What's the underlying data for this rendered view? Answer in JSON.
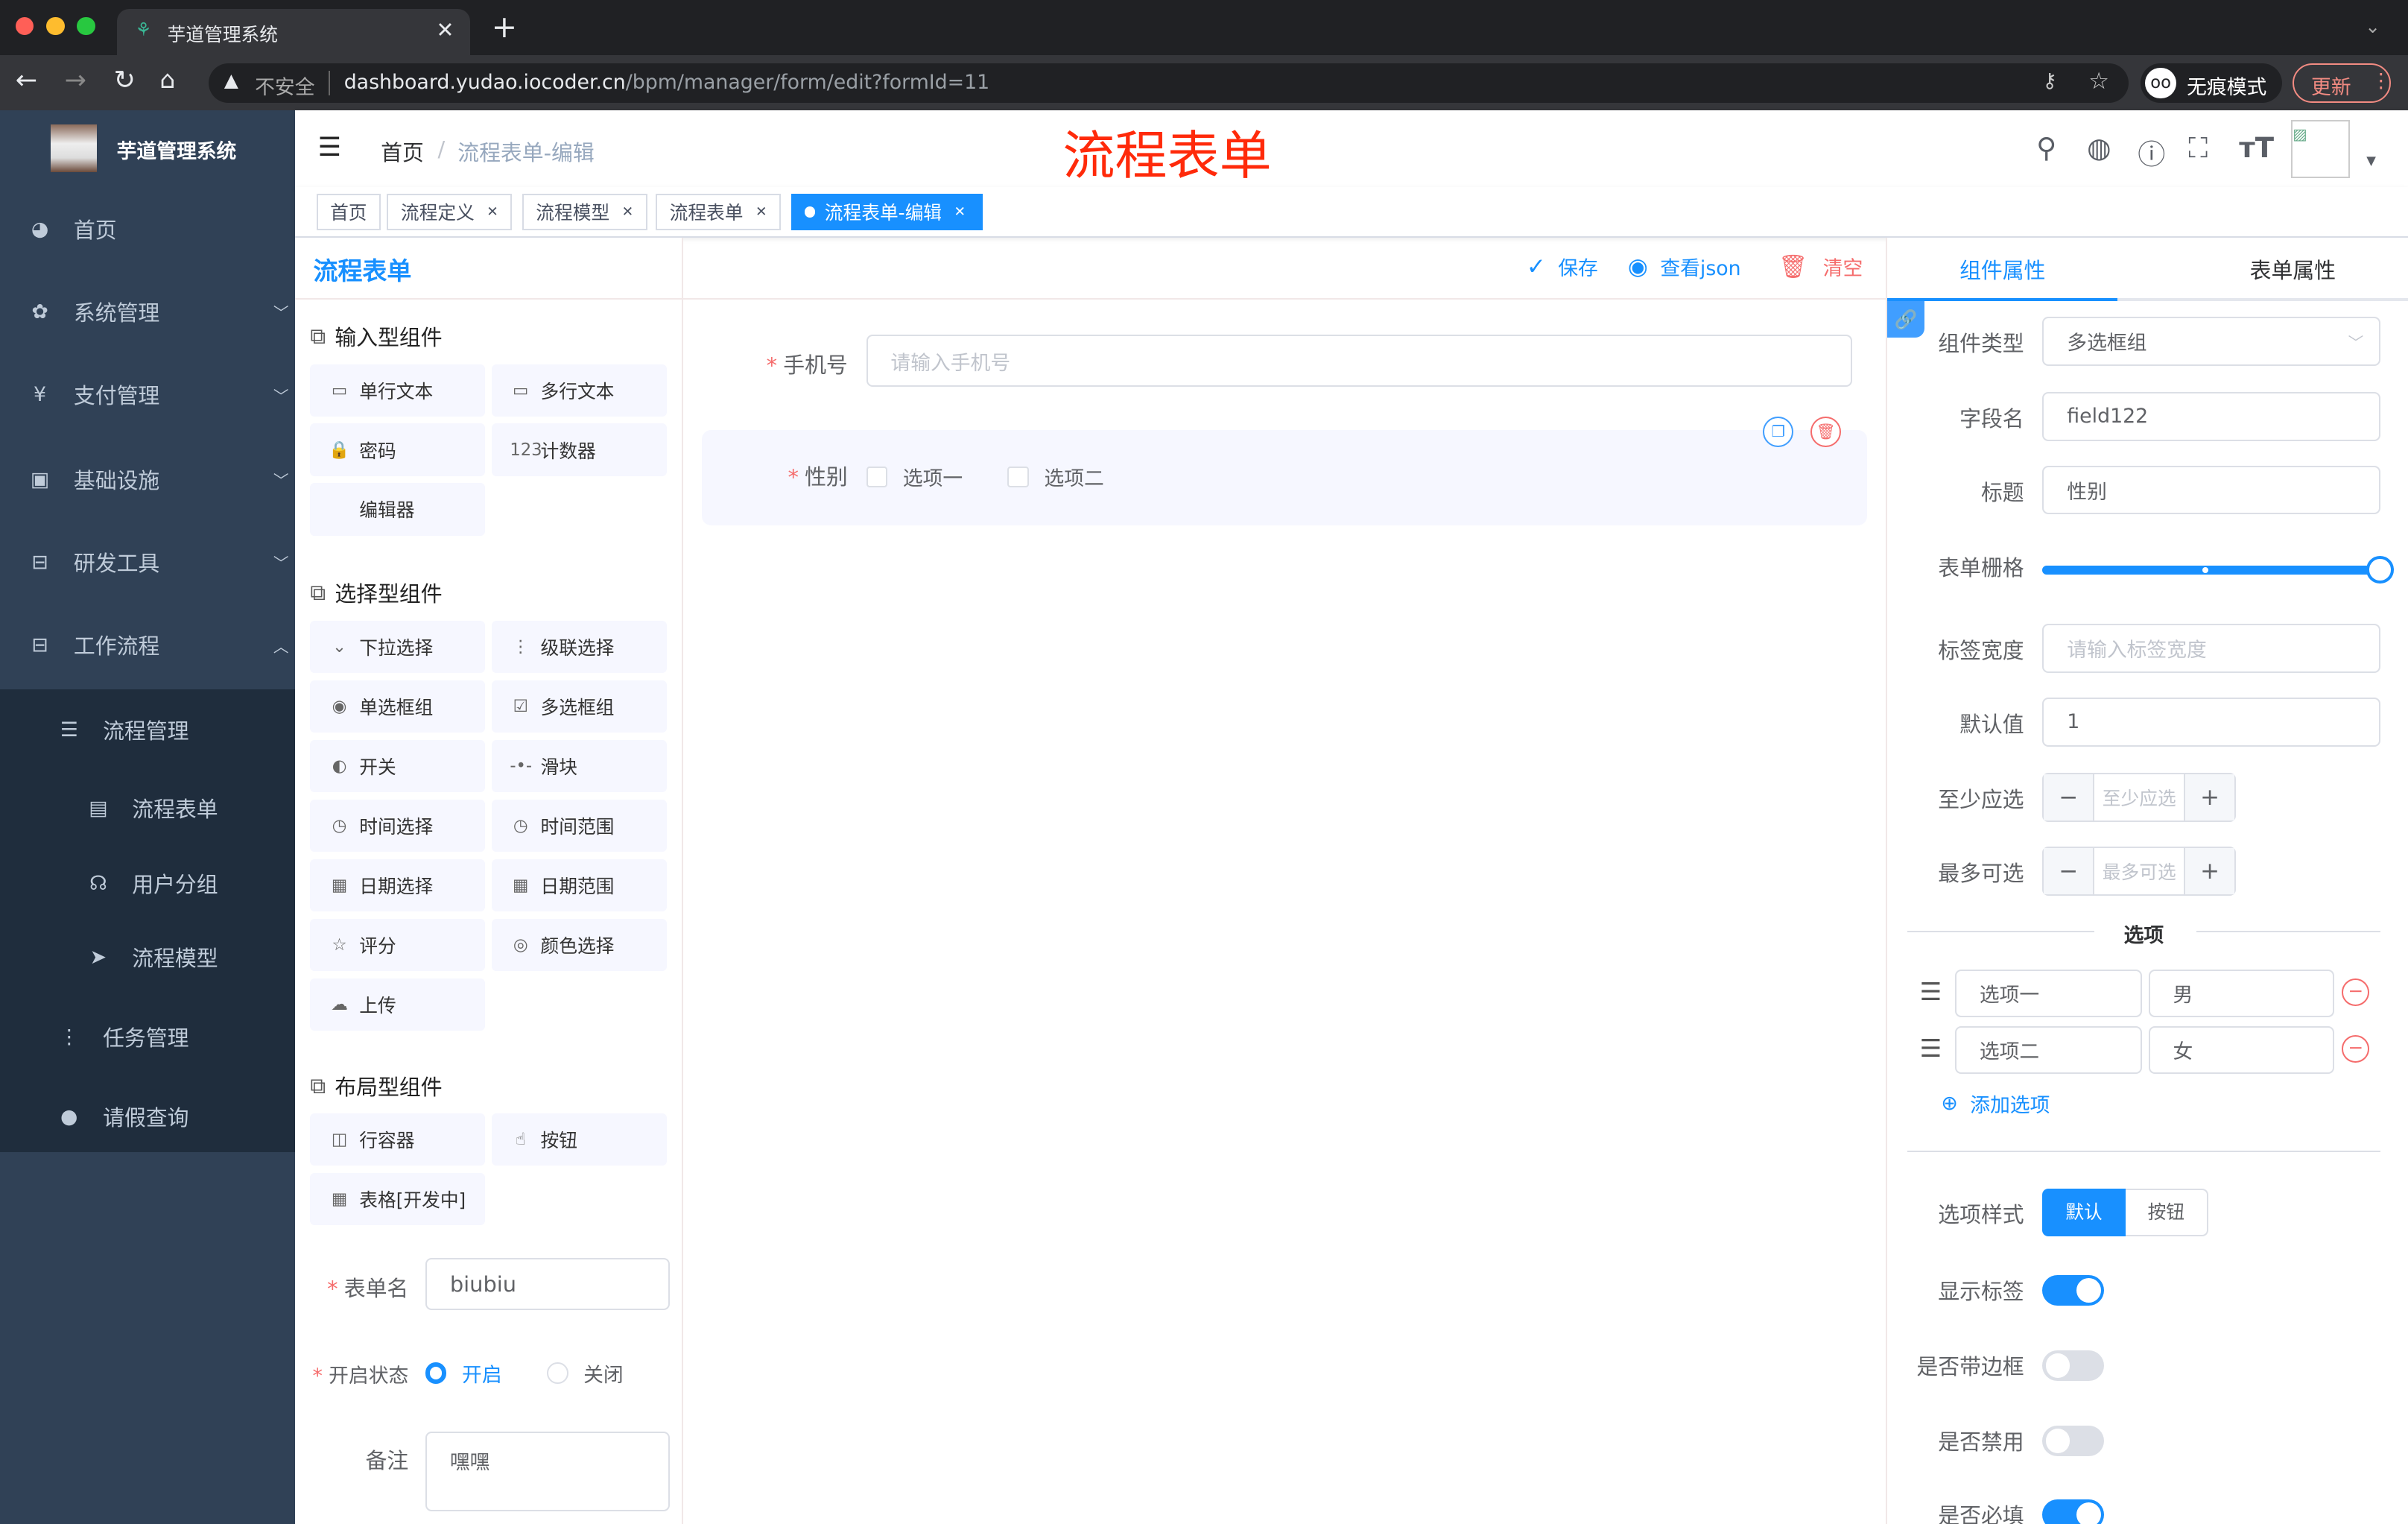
{
  "browser": {
    "tab_title": "芋道管理系统",
    "insecure": "不安全",
    "url_host": "dashboard.yudao.iocoder.cn",
    "url_path": "/bpm/manager/form/edit?formId=11",
    "incognito": "无痕模式",
    "update": "更新"
  },
  "sidebar": {
    "logo_title": "芋道管理系统",
    "items": [
      {
        "label": "首页",
        "icon": "dashboard-icon"
      },
      {
        "label": "系统管理",
        "icon": "gear-icon"
      },
      {
        "label": "支付管理",
        "icon": "yen-icon"
      },
      {
        "label": "基础设施",
        "icon": "monitor-icon"
      },
      {
        "label": "研发工具",
        "icon": "toolbox-icon"
      },
      {
        "label": "工作流程",
        "icon": "toolbox-icon"
      },
      {
        "label": "流程管理",
        "icon": "tree-icon"
      },
      {
        "label": "流程表单",
        "icon": "form-icon"
      },
      {
        "label": "用户分组",
        "icon": "group-icon"
      },
      {
        "label": "流程模型",
        "icon": "send-icon"
      },
      {
        "label": "任务管理",
        "icon": "tree-icon"
      },
      {
        "label": "请假查询",
        "icon": "user-icon"
      }
    ]
  },
  "navbar": {
    "breadcrumb_home": "首页",
    "breadcrumb_current": "流程表单-编辑",
    "page_banner": "流程表单"
  },
  "tags": [
    {
      "label": "首页"
    },
    {
      "label": "流程定义"
    },
    {
      "label": "流程模型"
    },
    {
      "label": "流程表单"
    },
    {
      "label": "流程表单-编辑"
    }
  ],
  "left": {
    "sections": [
      {
        "title": "输入型组件",
        "items": [
          {
            "label": "单行文本",
            "icon": "▭"
          },
          {
            "label": "多行文本",
            "icon": "▭"
          },
          {
            "label": "密码",
            "icon": "🔒"
          },
          {
            "label": "计数器",
            "icon": "123"
          },
          {
            "label": "编辑器",
            "icon": ""
          }
        ]
      },
      {
        "title": "选择型组件",
        "items": [
          {
            "label": "下拉选择",
            "icon": "⌄"
          },
          {
            "label": "级联选择",
            "icon": "⋮"
          },
          {
            "label": "单选框组",
            "icon": "◉"
          },
          {
            "label": "多选框组",
            "icon": "☑"
          },
          {
            "label": "开关",
            "icon": "◐"
          },
          {
            "label": "滑块",
            "icon": "-•-"
          },
          {
            "label": "时间选择",
            "icon": "◷"
          },
          {
            "label": "时间范围",
            "icon": "◷"
          },
          {
            "label": "日期选择",
            "icon": "▦"
          },
          {
            "label": "日期范围",
            "icon": "▦"
          },
          {
            "label": "评分",
            "icon": "☆"
          },
          {
            "label": "颜色选择",
            "icon": "◎"
          },
          {
            "label": "上传",
            "icon": "☁"
          }
        ]
      },
      {
        "title": "布局型组件",
        "items": [
          {
            "label": "行容器",
            "icon": "◫"
          },
          {
            "label": "按钮",
            "icon": "☝"
          },
          {
            "label": "表格[开发中]",
            "icon": "▦"
          }
        ]
      }
    ],
    "form_name_label": "表单名",
    "form_name_value": "biubiu",
    "status_label": "开启状态",
    "status_on": "开启",
    "status_off": "关闭",
    "status_selected": "开启",
    "remark_label": "备注",
    "remark_value": "嘿嘿"
  },
  "center": {
    "title": "流程表单",
    "save": "保存",
    "view_json": "查看json",
    "clear": "清空",
    "phone_label": "手机号",
    "phone_placeholder": "请输入手机号",
    "gender_label": "性别",
    "gender_options": [
      "选项一",
      "选项二"
    ]
  },
  "right": {
    "tab_component": "组件属性",
    "tab_form": "表单属性",
    "component_type_label": "组件类型",
    "component_type_value": "多选框组",
    "field_label": "字段名",
    "field_value": "field122",
    "title_label": "标题",
    "title_value": "性别",
    "grid_label": "表单栅格",
    "grid_value": 24,
    "label_width_label": "标签宽度",
    "label_width_placeholder": "请输入标签宽度",
    "default_label": "默认值",
    "default_value": "1",
    "min_label": "至少应选",
    "min_placeholder": "至少应选",
    "max_label": "最多可选",
    "max_placeholder": "最多可选",
    "options_divider": "选项",
    "options": [
      {
        "label": "选项一",
        "value": "男"
      },
      {
        "label": "选项二",
        "value": "女"
      }
    ],
    "add_option": "添加选项",
    "style_label": "选项样式",
    "style_default": "默认",
    "style_button": "按钮",
    "show_label": "显示标签",
    "show_label_on": true,
    "border_label": "是否带边框",
    "border_on": false,
    "disabled_label": "是否禁用",
    "disabled_on": false,
    "required_label": "是否必填",
    "required_on": true
  },
  "colors": {
    "primary": "#1890ff",
    "danger": "#f56c6c",
    "sidebar": "#304156",
    "banner": "#ff2a0a"
  }
}
